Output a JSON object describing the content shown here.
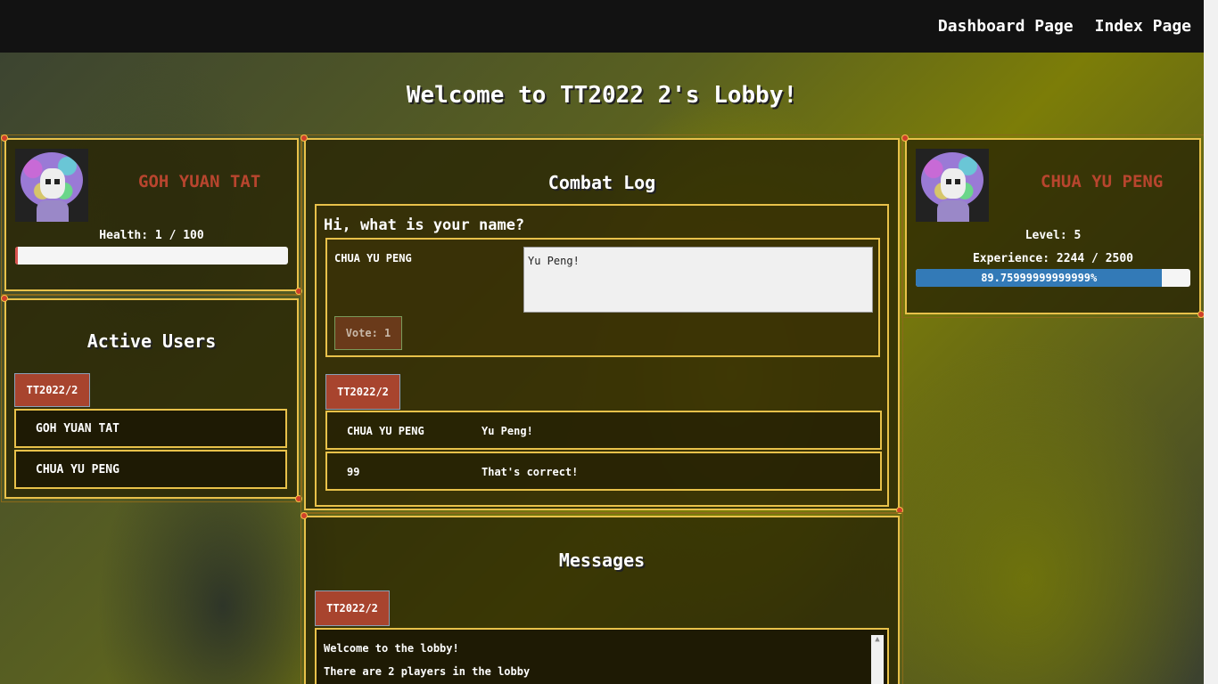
{
  "nav": {
    "dashboard": "Dashboard Page",
    "index": "Index Page"
  },
  "lobby_title": "Welcome to TT2022 2's Lobby!",
  "player": {
    "name": "GOH YUAN TAT",
    "health_text": "Health: 1 / 100",
    "health_fraction": 0.01
  },
  "active_users": {
    "heading": "Active Users",
    "tab": "TT2022/2",
    "users": [
      "GOH YUAN TAT",
      "CHUA YU PENG"
    ]
  },
  "combat_log": {
    "heading": "Combat Log",
    "question": "Hi, what is your name?",
    "answerer": "CHUA YU PENG",
    "answer": "Yu Peng!",
    "vote": "Vote: 1",
    "tab": "TT2022/2",
    "entries": [
      {
        "name": "CHUA YU PENG",
        "message": "Yu Peng!"
      },
      {
        "name": "99",
        "message": "That's correct!"
      }
    ]
  },
  "opponent": {
    "name": "CHUA YU PENG",
    "level_text": "Level: 5",
    "experience_text": "Experience: 2244 / 2500",
    "experience_percent_text": "89.75999999999999%",
    "experience_fraction": 0.8976
  },
  "messages": {
    "heading": "Messages",
    "tab": "TT2022/2",
    "lines": [
      "Welcome to the lobby!",
      "There are 2 players in the lobby"
    ]
  },
  "colors": {
    "accent_border": "#e8c14a",
    "name_red": "#b8452e",
    "tab_red": "#a8442e",
    "progress_blue": "#337ab7"
  }
}
